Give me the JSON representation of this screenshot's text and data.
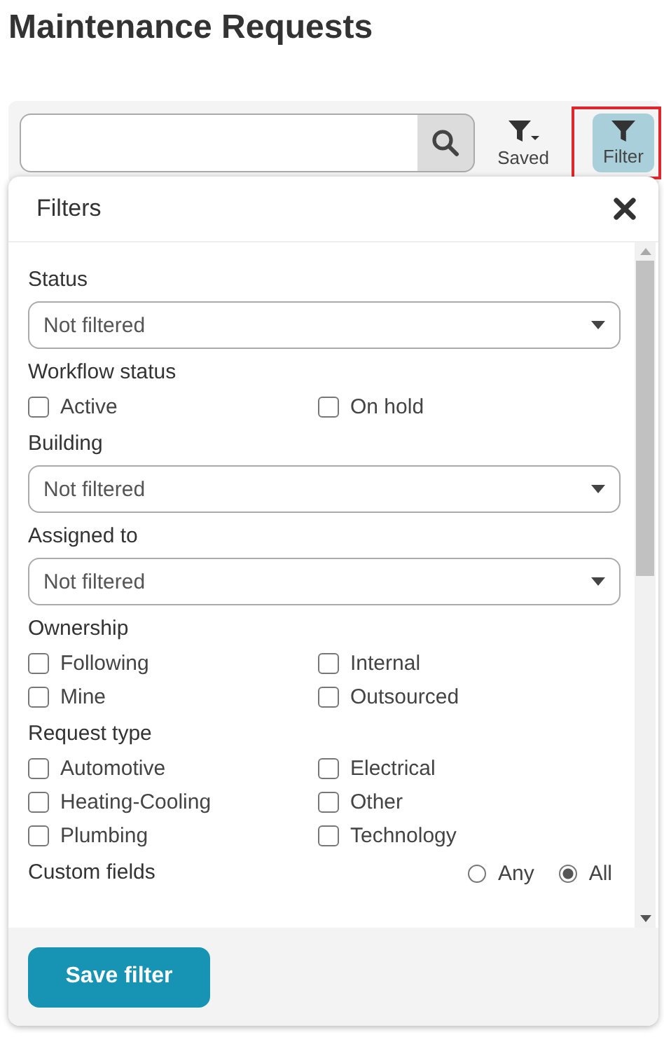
{
  "page_title": "Maintenance Requests",
  "toolbar": {
    "saved_button": {
      "label": "Saved"
    },
    "filter_button": {
      "label": "Filter",
      "selected": true
    }
  },
  "panel": {
    "title": "Filters",
    "sections": [
      {
        "kind": "select",
        "label": "Status",
        "value": "Not filtered"
      },
      {
        "kind": "checkboxes",
        "label": "Workflow status",
        "options": [
          {
            "label": "Active",
            "checked": false
          },
          {
            "label": "On hold",
            "checked": false
          }
        ]
      },
      {
        "kind": "select",
        "label": "Building",
        "value": "Not filtered"
      },
      {
        "kind": "select",
        "label": "Assigned to",
        "value": "Not filtered"
      },
      {
        "kind": "checkboxes",
        "label": "Ownership",
        "options": [
          {
            "label": "Following",
            "checked": false
          },
          {
            "label": "Internal",
            "checked": false
          },
          {
            "label": "Mine",
            "checked": false
          },
          {
            "label": "Outsourced",
            "checked": false
          }
        ]
      },
      {
        "kind": "checkboxes",
        "label": "Request type",
        "options": [
          {
            "label": "Automotive",
            "checked": false
          },
          {
            "label": "Electrical",
            "checked": false
          },
          {
            "label": "Heating-Cooling",
            "checked": false
          },
          {
            "label": "Other",
            "checked": false
          },
          {
            "label": "Plumbing",
            "checked": false
          },
          {
            "label": "Technology",
            "checked": false
          }
        ]
      },
      {
        "kind": "radio",
        "label": "Custom fields",
        "options": [
          {
            "label": "Any",
            "selected": false
          },
          {
            "label": "All",
            "selected": true
          }
        ]
      }
    ],
    "save_button": {
      "label": "Save filter"
    }
  }
}
